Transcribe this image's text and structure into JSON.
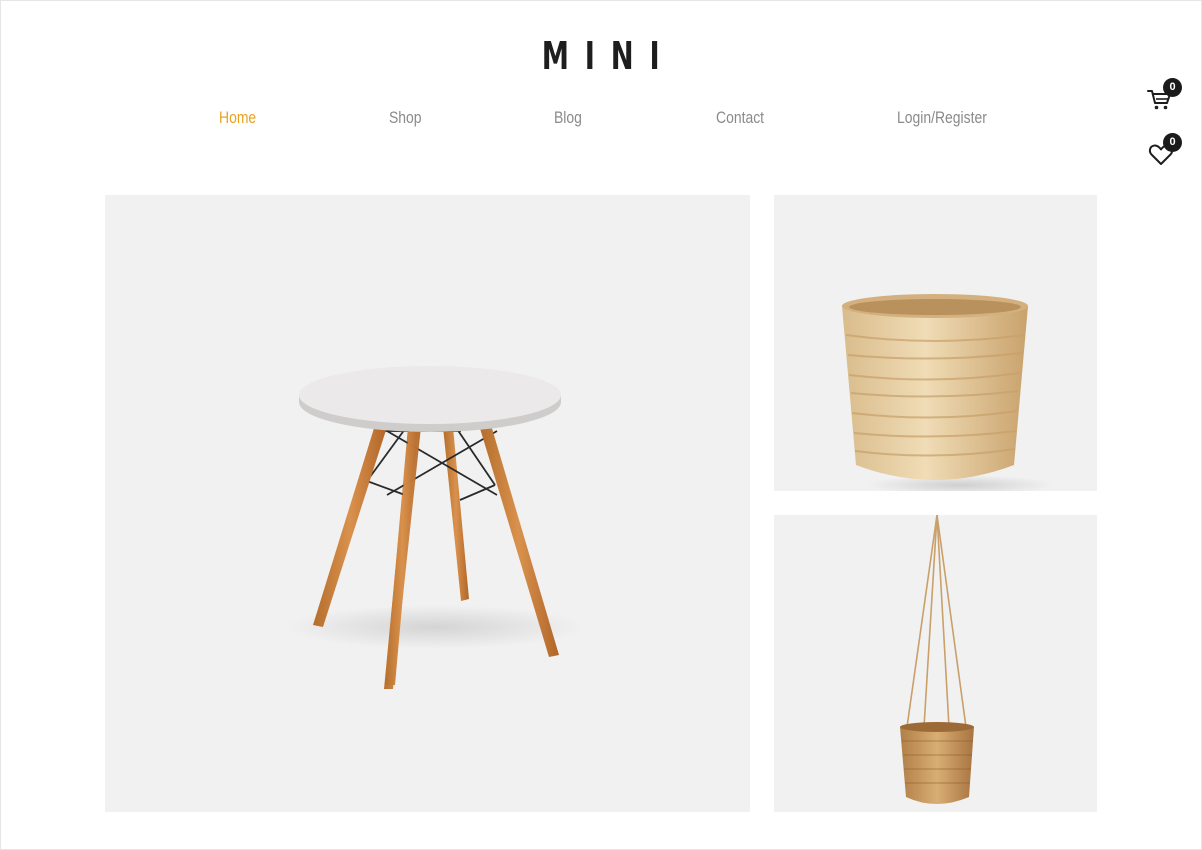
{
  "brand": {
    "logo_text": "MINI"
  },
  "nav": {
    "items": [
      {
        "label": "Home",
        "active": true
      },
      {
        "label": "Shop",
        "active": false
      },
      {
        "label": "Blog",
        "active": false
      },
      {
        "label": "Contact",
        "active": false
      },
      {
        "label": "Login/Register",
        "active": false
      }
    ]
  },
  "cart": {
    "icon": "cart-icon",
    "count": "0"
  },
  "wishlist": {
    "icon": "heart-icon",
    "count": "0"
  },
  "products": [
    {
      "icon": "round-table-image"
    },
    {
      "icon": "bamboo-pot-image"
    },
    {
      "icon": "hanging-basket-image"
    }
  ],
  "colors": {
    "accent": "#e9a21f",
    "nav_text": "#8a8a8a",
    "logo": "#1e1e1e",
    "tile_bg": "#f1f1f1"
  }
}
